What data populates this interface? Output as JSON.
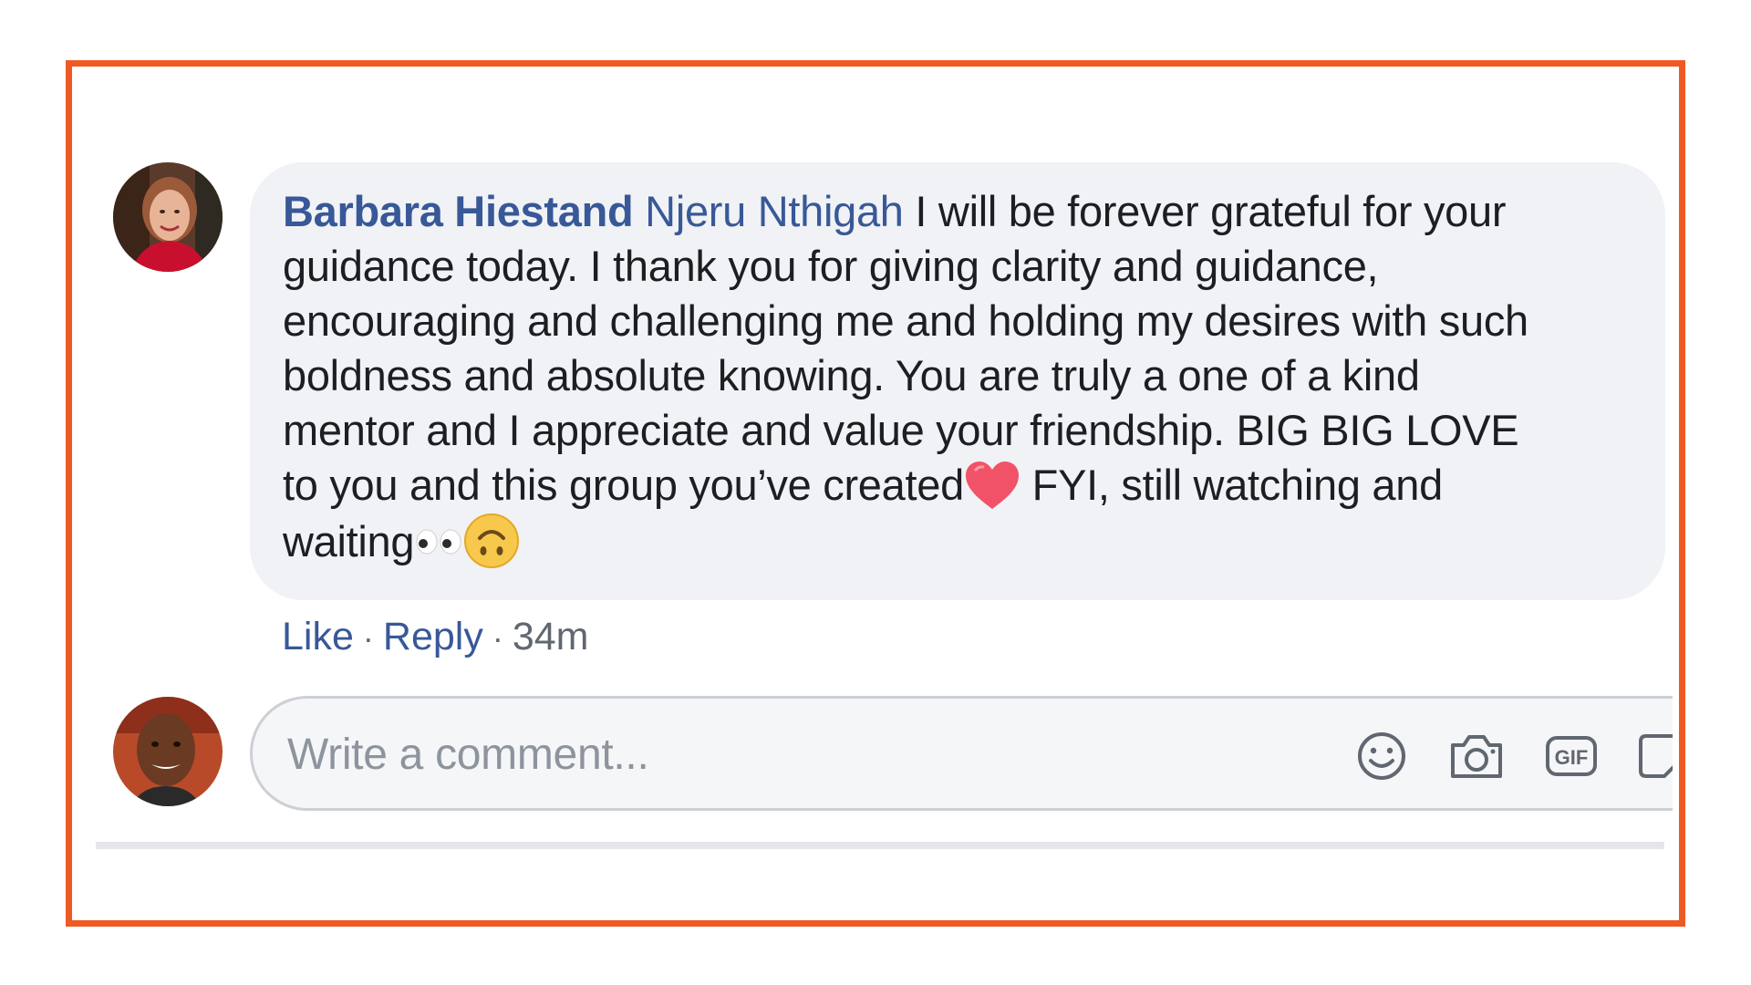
{
  "comment": {
    "author": "Barbara Hiestand",
    "mention": "Njeru Nthigah",
    "text_line1": " I will be forever grateful for your",
    "text_line2": "guidance today. I thank you for giving clarity and guidance,",
    "text_line3": "encouraging and challenging me and holding my desires with such",
    "text_line4": "boldness and absolute knowing. You are truly a one of a kind",
    "text_line5": "mentor and I appreciate and value your friendship. BIG BIG LOVE",
    "text_line6a": "to you and this group you’ve created",
    "text_line6b": " FYI, still watching and",
    "text_line7": "waiting",
    "emojis": [
      "heart-icon",
      "eyes-icon",
      "upside-down-face-icon"
    ]
  },
  "actions": {
    "like": "Like",
    "separator": "·",
    "reply": "Reply",
    "time": "34m"
  },
  "composer": {
    "placeholder": "Write a comment...",
    "tools": [
      "emoji-icon",
      "camera-icon",
      "gif-icon",
      "sticker-icon"
    ],
    "gif_label": "GIF"
  },
  "colors": {
    "frame": "#ee5a24",
    "link": "#385898",
    "bubble": "#f0f2f5",
    "text": "#1c1e21",
    "muted": "#606770"
  }
}
